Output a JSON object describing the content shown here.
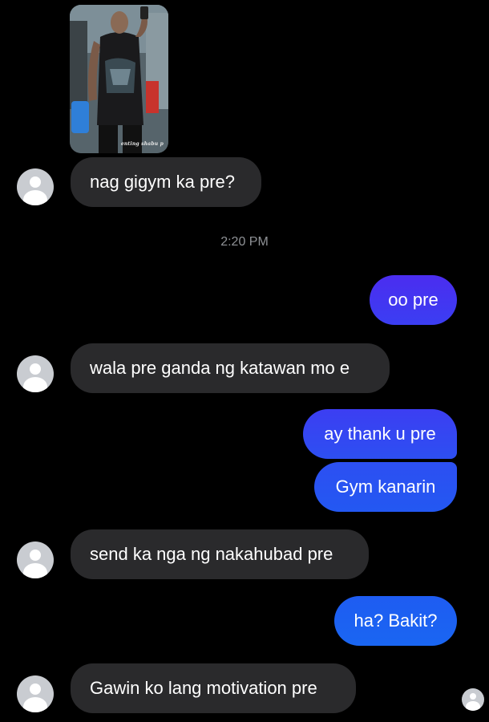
{
  "conversation": {
    "photo_caption": "enting shabu p",
    "timestamp": "2:20 PM",
    "messages": [
      {
        "sender": "them",
        "text": "nag gigym ka pre?"
      },
      {
        "sender": "me",
        "text": "oo pre"
      },
      {
        "sender": "them",
        "text": "wala pre ganda ng katawan mo e"
      },
      {
        "sender": "me",
        "text": "ay thank u pre"
      },
      {
        "sender": "me",
        "text": "Gym kanarin"
      },
      {
        "sender": "them",
        "text": "send ka nga ng nakahubad pre"
      },
      {
        "sender": "me",
        "text": "ha? Bakit?"
      },
      {
        "sender": "them",
        "text": "Gawin ko lang motivation pre"
      }
    ]
  },
  "colors": {
    "background": "#000000",
    "incoming_bubble": "#2a2a2c",
    "outgoing_gradient_top": "#4f2cf0",
    "outgoing_gradient_bottom": "#1f64f2",
    "timestamp_text": "#8f9296",
    "avatar": "#c9ccd1"
  },
  "icons": {
    "avatar": "default-user-avatar-icon",
    "seen_indicator": "seen-avatar-icon"
  }
}
